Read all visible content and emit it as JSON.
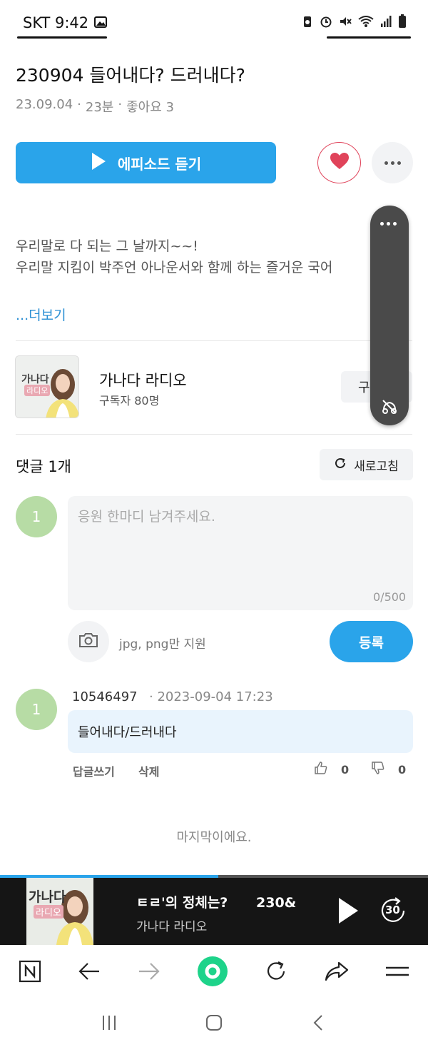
{
  "status_bar": {
    "carrier_time": "SKT 9:42",
    "icons": [
      "gallery-icon",
      "battery-saver-icon",
      "alarm-icon",
      "mute-icon",
      "wifi-icon",
      "signal-icon",
      "battery-icon"
    ]
  },
  "episode": {
    "title": "230904 들어내다? 드러내다?",
    "date": "23.09.04",
    "duration": "23분",
    "likes": "좋아요 3",
    "play_label": "에피소드 듣기",
    "description_line1": "우리말로 다 되는 그 날까지~~!",
    "description_line2": "우리말 지킴이 박주언 아나운서와 함께 하는 즐거운 국어",
    "more_label": "...더보기"
  },
  "channel": {
    "thumb_text_1": "가나다",
    "thumb_text_2": "라디오",
    "name": "가나다 라디오",
    "subscribers": "구독자 80명",
    "subscribe_label": "구"
  },
  "comments": {
    "header": "댓글 1개",
    "refresh_label": "새로고침",
    "my_avatar": "1",
    "input_placeholder": "응원 한마디 남겨주세요.",
    "char_count": "0/500",
    "image_hint": "jpg, png만 지원",
    "submit_label": "등록",
    "items": [
      {
        "avatar": "1",
        "author": "10546497",
        "date": "· 2023-09-04 17:23",
        "text": "들어내다/드러내다",
        "reply_label": "답글쓰기",
        "delete_label": "삭제",
        "likes": "0",
        "dislikes": "0"
      }
    ],
    "end_text": "마지막이에요."
  },
  "mini_player": {
    "thumb_text_1": "가나다",
    "thumb_text_2": "라디오",
    "title": "ㅌㄹ'의 정체는?      230&",
    "channel": "가나다 라디오",
    "skip_label": "30",
    "progress": 0.51
  },
  "colors": {
    "accent": "#2aa4ea",
    "like": "#e0435a",
    "avatar": "#b7dca5",
    "refresh": "#1ed38a"
  }
}
